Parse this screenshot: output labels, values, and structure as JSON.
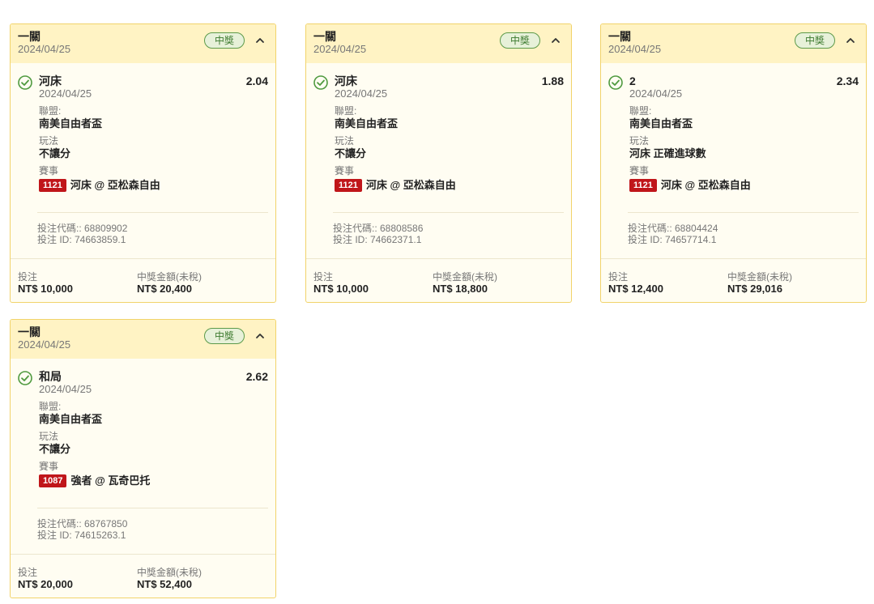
{
  "labels": {
    "league": "聯盟:",
    "market": "玩法",
    "event": "賽事",
    "bet_code_prefix": "投注代碼::",
    "bet_id_prefix": "投注 ID:",
    "stake": "投注",
    "payout": "中獎金額(未稅)"
  },
  "colors": {
    "header_bg": "#fff3c4",
    "card_border": "#f1d36a",
    "badge_green": "#3c7a2e",
    "event_code_red": "#c0161a"
  },
  "tickets": [
    {
      "bet_type": "一關",
      "date": "2024/04/25",
      "status": "中獎",
      "selection": "河床",
      "odds": "2.04",
      "selection_date": "2024/04/25",
      "league": "南美自由者盃",
      "market": "不讓分",
      "event_code": "1121",
      "event_name": "河床 @ 亞松森自由",
      "bet_code": "投注代碼:: 68809902",
      "bet_id": "投注 ID: 74663859.1",
      "stake": "NT$ 10,000",
      "payout": "NT$ 20,400"
    },
    {
      "bet_type": "一關",
      "date": "2024/04/25",
      "status": "中獎",
      "selection": "河床",
      "odds": "1.88",
      "selection_date": "2024/04/25",
      "league": "南美自由者盃",
      "market": "不讓分",
      "event_code": "1121",
      "event_name": "河床 @ 亞松森自由",
      "bet_code": "投注代碼:: 68808586",
      "bet_id": "投注 ID: 74662371.1",
      "stake": "NT$ 10,000",
      "payout": "NT$ 18,800"
    },
    {
      "bet_type": "一關",
      "date": "2024/04/25",
      "status": "中獎",
      "selection": "2",
      "odds": "2.34",
      "selection_date": "2024/04/25",
      "league": "南美自由者盃",
      "market": "河床 正確進球數",
      "event_code": "1121",
      "event_name": "河床 @ 亞松森自由",
      "bet_code": "投注代碼:: 68804424",
      "bet_id": "投注 ID: 74657714.1",
      "stake": "NT$ 12,400",
      "payout": "NT$ 29,016"
    },
    {
      "bet_type": "一關",
      "date": "2024/04/25",
      "status": "中獎",
      "selection": "和局",
      "odds": "2.62",
      "selection_date": "2024/04/25",
      "league": "南美自由者盃",
      "market": "不讓分",
      "event_code": "1087",
      "event_name": "強者 @ 瓦奇巴托",
      "bet_code": "投注代碼:: 68767850",
      "bet_id": "投注 ID: 74615263.1",
      "stake": "NT$ 20,000",
      "payout": "NT$ 52,400"
    }
  ]
}
